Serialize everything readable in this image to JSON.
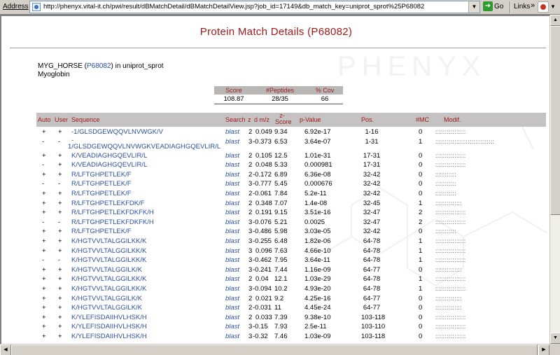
{
  "browser": {
    "address_label": "Address",
    "url": "http://phenyx.vital-it.ch/pwi/result/dBMatchDetail/dBMatchDetailView.jsp?job_id=17149&db_match_key=uniprot_sprot%25P68082",
    "go_label": "Go",
    "links_label": "Links"
  },
  "page": {
    "title": "Protein Match Details (P68082)",
    "protein": {
      "name": "MYG_HORSE",
      "accession": "P68082",
      "database_text": "in uniprot_sprot",
      "description": "Myoglobin"
    },
    "summary": {
      "headers": [
        "Score",
        "#Peptides",
        "% Cov"
      ],
      "values": [
        "108.87",
        "28/35",
        "66"
      ]
    },
    "table": {
      "headers": {
        "auto": "Auto",
        "user": "User",
        "sequence": "Sequence",
        "search": "Search",
        "z": "z",
        "d_mz": "d m/z",
        "z_score": "z-Score",
        "p_value": "p-Value",
        "pos": "Pos.",
        "mc": "#MC",
        "modif": "Modif."
      },
      "rows": [
        {
          "auto": "+",
          "user": "+",
          "seq": "-1/GLSDGEWQQVLNVWGK/V",
          "search": "blast",
          "z": "2",
          "dmz": "0.049",
          "zscore": "9.34",
          "pvalue": "6.92e-17",
          "pos": "1-16",
          "mc": "0",
          "modif": "::::::::::::::::"
        },
        {
          "auto": "-",
          "user": "-",
          "seq": "-1/GLSDGEWQQVLNVWGKVEADIAGHGQEVLIR/L",
          "search": "blast",
          "z": "3",
          "dmz": "-0.373",
          "zscore": "6.53",
          "pvalue": "3.64e-07",
          "pos": "1-31",
          "mc": "1",
          "modif": ":::::::::::::::::::::::::::::::"
        },
        {
          "auto": "+",
          "user": "+",
          "seq": "K/VEADIAGHGQEVLIR/L",
          "search": "blast",
          "z": "2",
          "dmz": "0.105",
          "zscore": "12.5",
          "pvalue": "1.01e-31",
          "pos": "17-31",
          "mc": "0",
          "modif": "::::::::::::::::"
        },
        {
          "auto": "-",
          "user": "+",
          "seq": "K/VEADIAGHGQEVLIR/L",
          "search": "blast",
          "z": "2",
          "dmz": "0.048",
          "zscore": "5.33",
          "pvalue": "0.000981",
          "pos": "17-31",
          "mc": "0",
          "modif": "::::::::::::::::"
        },
        {
          "auto": "+",
          "user": "+",
          "seq": "R/LFTGHPETLEK/F",
          "search": "blast",
          "z": "2",
          "dmz": "-0.172",
          "zscore": "6.89",
          "pvalue": "6.36e-08",
          "pos": "32-42",
          "mc": "0",
          "modif": ":::::::::::"
        },
        {
          "auto": "-",
          "user": "-",
          "seq": "R/LFTGHPETLEK/F",
          "search": "blast",
          "z": "3",
          "dmz": "-0.777",
          "zscore": "5.45",
          "pvalue": "0.000676",
          "pos": "32-42",
          "mc": "0",
          "modif": ":::::::::::"
        },
        {
          "auto": "+",
          "user": "+",
          "seq": "R/LFTGHPETLEK/F",
          "search": "blast",
          "z": "2",
          "dmz": "-0.061",
          "zscore": "7.84",
          "pvalue": "5.2e-11",
          "pos": "32-42",
          "mc": "0",
          "modif": ":::::::::::"
        },
        {
          "auto": "+",
          "user": "+",
          "seq": "R/LFTGHPETLEKFDK/F",
          "search": "blast",
          "z": "2",
          "dmz": "0.348",
          "zscore": "7.07",
          "pvalue": "1.4e-08",
          "pos": "32-45",
          "mc": "1",
          "modif": "::::::::::::::"
        },
        {
          "auto": "+",
          "user": "+",
          "seq": "R/LFTGHPETLEKFDKFK/H",
          "search": "blast",
          "z": "2",
          "dmz": "0.191",
          "zscore": "9.15",
          "pvalue": "3.51e-16",
          "pos": "32-47",
          "mc": "2",
          "modif": "::::::::::::::::"
        },
        {
          "auto": "-",
          "user": "-",
          "seq": "R/LFTGHPETLEKFDKFK/H",
          "search": "blast",
          "z": "3",
          "dmz": "-0.076",
          "zscore": "5.21",
          "pvalue": "0.0025",
          "pos": "32-47",
          "mc": "2",
          "modif": "::::::::::::::::"
        },
        {
          "auto": "+",
          "user": "+",
          "seq": "R/LFTGHPETLEK/F",
          "search": "blast",
          "z": "3",
          "dmz": "-0.486",
          "zscore": "5.98",
          "pvalue": "3.03e-05",
          "pos": "32-42",
          "mc": "0",
          "modif": ":::::::::::"
        },
        {
          "auto": "+",
          "user": "+",
          "seq": "K/HGTVVLTALGGILKK/K",
          "search": "blast",
          "z": "3",
          "dmz": "-0.255",
          "zscore": "6.48",
          "pvalue": "1.82e-06",
          "pos": "64-78",
          "mc": "1",
          "modif": "::::::::::::::::"
        },
        {
          "auto": "+",
          "user": "+",
          "seq": "K/HGTVVLTALGGILKK/K",
          "search": "blast",
          "z": "3",
          "dmz": "0.096",
          "zscore": "7.63",
          "pvalue": "4.66e-10",
          "pos": "64-78",
          "mc": "1",
          "modif": "::::::::::::::::"
        },
        {
          "auto": "-",
          "user": "-",
          "seq": "K/HGTVVLTALGGILKK/K",
          "search": "blast",
          "z": "3",
          "dmz": "-0.462",
          "zscore": "7.95",
          "pvalue": "3.64e-11",
          "pos": "64-78",
          "mc": "1",
          "modif": "::::::::::::::::"
        },
        {
          "auto": "+",
          "user": "+",
          "seq": "K/HGTVVLTALGGILK/K",
          "search": "blast",
          "z": "3",
          "dmz": "-0.241",
          "zscore": "7.44",
          "pvalue": "1.16e-09",
          "pos": "64-77",
          "mc": "0",
          "modif": "::::::::::::::"
        },
        {
          "auto": "+",
          "user": "+",
          "seq": "K/HGTVVLTALGGILKK/K",
          "search": "blast",
          "z": "2",
          "dmz": "0.04",
          "zscore": "12.1",
          "pvalue": "1.03e-29",
          "pos": "64-78",
          "mc": "1",
          "modif": "::::::::::::::::"
        },
        {
          "auto": "+",
          "user": "+",
          "seq": "K/HGTVVLTALGGILKK/K",
          "search": "blast",
          "z": "3",
          "dmz": "-0.094",
          "zscore": "10.2",
          "pvalue": "4.93e-20",
          "pos": "64-78",
          "mc": "1",
          "modif": "::::::::::::::::"
        },
        {
          "auto": "+",
          "user": "+",
          "seq": "K/HGTVVLTALGGILK/K",
          "search": "blast",
          "z": "2",
          "dmz": "0.021",
          "zscore": "9.2",
          "pvalue": "4.25e-16",
          "pos": "64-77",
          "mc": "0",
          "modif": "::::::::::::::"
        },
        {
          "auto": "+",
          "user": "+",
          "seq": "K/HGTVVLTALGGILK/K",
          "search": "blast",
          "z": "2",
          "dmz": "-0.031",
          "zscore": "11",
          "pvalue": "4.45e-24",
          "pos": "64-77",
          "mc": "0",
          "modif": "::::::::::::::"
        },
        {
          "auto": "+",
          "user": "+",
          "seq": "K/YLEFISDAIIHVLHSK/H",
          "search": "blast",
          "z": "2",
          "dmz": "0.033",
          "zscore": "7.39",
          "pvalue": "9.38e-10",
          "pos": "103-118",
          "mc": "0",
          "modif": "::::::::::::::::"
        },
        {
          "auto": "+",
          "user": "+",
          "seq": "K/YLEFISDAIIHVLHSK/H",
          "search": "blast",
          "z": "3",
          "dmz": "-0.15",
          "zscore": "7.93",
          "pvalue": "2.5e-11",
          "pos": "103-110",
          "mc": "0",
          "modif": "::::::::::::::::"
        },
        {
          "auto": "+",
          "user": "+",
          "seq": "K/YLEFISDAIIHVLHSK/H",
          "search": "blast",
          "z": "3",
          "dmz": "-0.32",
          "zscore": "7.46",
          "pvalue": "1.03e-09",
          "pos": "103-118",
          "mc": "0",
          "modif": "::::::::::::::::"
        }
      ]
    }
  },
  "colors": {
    "title": "#a11a1a",
    "link": "#2a4f9e",
    "header_bg": "#c4c2c2"
  }
}
